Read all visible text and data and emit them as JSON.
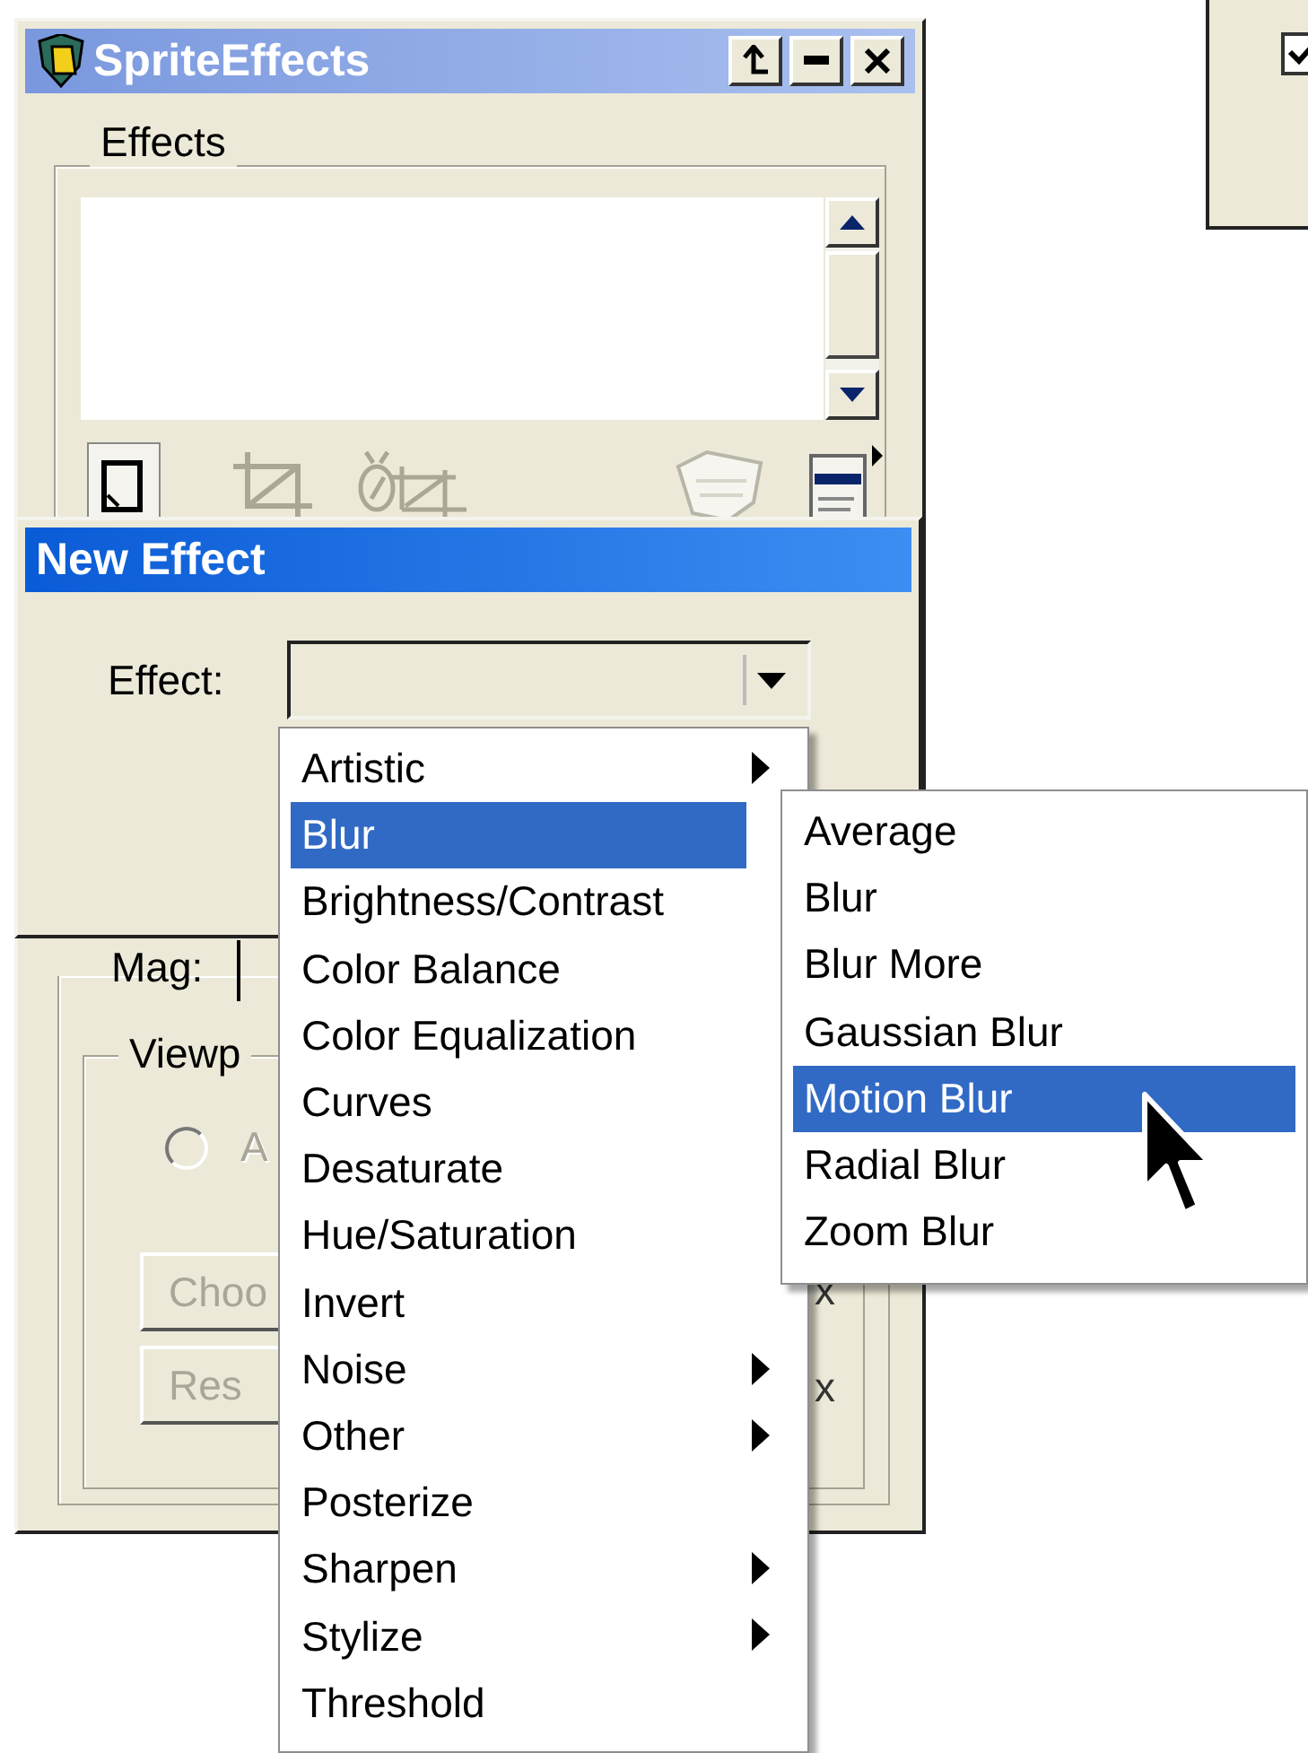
{
  "sprite_effects_window": {
    "title": "SpriteEffects",
    "effects_group": {
      "label": "Effects"
    },
    "mag_label": "Mag:",
    "viewport_group": {
      "label": "Viewp",
      "radio": {
        "label": "A",
        "selected": false
      },
      "buttons": [
        "Choo",
        "Res"
      ],
      "marks": [
        "x",
        "x"
      ]
    }
  },
  "side_window": {
    "checkbox": {
      "checked": true
    }
  },
  "new_effect_dialog": {
    "title": "New Effect",
    "effect_label": "Effect:"
  },
  "effect_menu": [
    {
      "label": "Artistic",
      "submenu": true,
      "selected": false
    },
    {
      "label": "Blur",
      "submenu": false,
      "selected": true
    },
    {
      "label": "Brightness/Contrast",
      "submenu": false,
      "selected": false
    },
    {
      "label": "Color Balance",
      "submenu": false,
      "selected": false
    },
    {
      "label": "Color Equalization",
      "submenu": false,
      "selected": false
    },
    {
      "label": "Curves",
      "submenu": false,
      "selected": false
    },
    {
      "label": "Desaturate",
      "submenu": false,
      "selected": false
    },
    {
      "label": "Hue/Saturation",
      "submenu": false,
      "selected": false
    },
    {
      "label": "Invert",
      "submenu": false,
      "selected": false
    },
    {
      "label": "Noise",
      "submenu": true,
      "selected": false
    },
    {
      "label": "Other",
      "submenu": true,
      "selected": false
    },
    {
      "label": "Posterize",
      "submenu": false,
      "selected": false
    },
    {
      "label": "Sharpen",
      "submenu": true,
      "selected": false
    },
    {
      "label": "Stylize",
      "submenu": true,
      "selected": false
    },
    {
      "label": "Threshold",
      "submenu": false,
      "selected": false
    }
  ],
  "blur_submenu": [
    {
      "label": "Average",
      "selected": false
    },
    {
      "label": "Blur",
      "selected": false
    },
    {
      "label": "Blur More",
      "selected": false
    },
    {
      "label": "Gaussian Blur",
      "selected": false
    },
    {
      "label": "Motion Blur",
      "selected": true
    },
    {
      "label": "Radial Blur",
      "selected": false
    },
    {
      "label": "Zoom Blur",
      "selected": false
    }
  ]
}
